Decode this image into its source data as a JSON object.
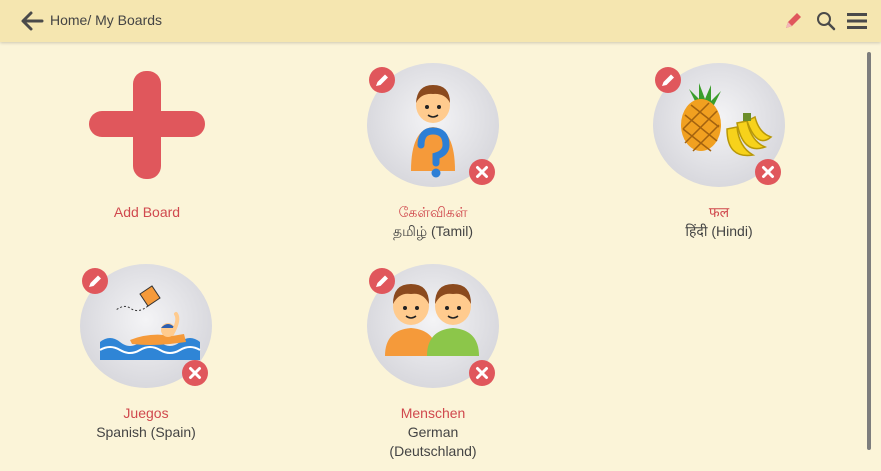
{
  "header": {
    "breadcrumb": "Home/ My Boards",
    "accent_color": "#e0575c",
    "bar_color": "#f5e6b0"
  },
  "add_board": {
    "label": "Add Board"
  },
  "boards": [
    {
      "name": "கேள்விகள்",
      "language": "தமிழ் (Tamil)",
      "icon": "question-boy-icon"
    },
    {
      "name": "फल",
      "language": "हिंदी (Hindi)",
      "icon": "fruits-icon"
    },
    {
      "name": "Juegos",
      "language": "Spanish (Spain)",
      "icon": "swimmer-kite-icon"
    },
    {
      "name": "Menschen",
      "language": "German",
      "language2": "(Deutschland)",
      "icon": "two-boys-icon"
    }
  ]
}
